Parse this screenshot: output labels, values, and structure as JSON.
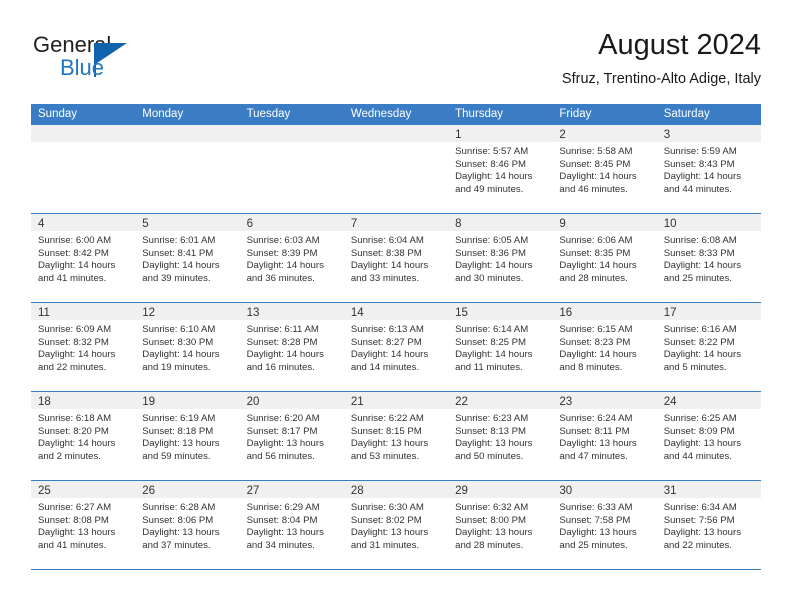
{
  "brand": {
    "name_part1": "General",
    "name_part2": "Blue",
    "accent_color": "#1263ad",
    "blue_text_color": "#1f76c2"
  },
  "header": {
    "title": "August 2024",
    "subtitle": "Sfruz, Trentino-Alto Adige, Italy"
  },
  "calendar": {
    "header_bg": "#3b7dc4",
    "day_strip_bg": "#f0f0f0",
    "weekdays": [
      "Sunday",
      "Monday",
      "Tuesday",
      "Wednesday",
      "Thursday",
      "Friday",
      "Saturday"
    ],
    "labels": {
      "sunrise": "Sunrise:",
      "sunset": "Sunset:",
      "daylight": "Daylight:"
    },
    "weeks": [
      [
        {
          "empty": true
        },
        {
          "empty": true
        },
        {
          "empty": true
        },
        {
          "empty": true
        },
        {
          "day": "1",
          "sunrise": "Sunrise: 5:57 AM",
          "sunset": "Sunset: 8:46 PM",
          "daylight_1": "Daylight: 14 hours",
          "daylight_2": "and 49 minutes."
        },
        {
          "day": "2",
          "sunrise": "Sunrise: 5:58 AM",
          "sunset": "Sunset: 8:45 PM",
          "daylight_1": "Daylight: 14 hours",
          "daylight_2": "and 46 minutes."
        },
        {
          "day": "3",
          "sunrise": "Sunrise: 5:59 AM",
          "sunset": "Sunset: 8:43 PM",
          "daylight_1": "Daylight: 14 hours",
          "daylight_2": "and 44 minutes."
        }
      ],
      [
        {
          "day": "4",
          "sunrise": "Sunrise: 6:00 AM",
          "sunset": "Sunset: 8:42 PM",
          "daylight_1": "Daylight: 14 hours",
          "daylight_2": "and 41 minutes."
        },
        {
          "day": "5",
          "sunrise": "Sunrise: 6:01 AM",
          "sunset": "Sunset: 8:41 PM",
          "daylight_1": "Daylight: 14 hours",
          "daylight_2": "and 39 minutes."
        },
        {
          "day": "6",
          "sunrise": "Sunrise: 6:03 AM",
          "sunset": "Sunset: 8:39 PM",
          "daylight_1": "Daylight: 14 hours",
          "daylight_2": "and 36 minutes."
        },
        {
          "day": "7",
          "sunrise": "Sunrise: 6:04 AM",
          "sunset": "Sunset: 8:38 PM",
          "daylight_1": "Daylight: 14 hours",
          "daylight_2": "and 33 minutes."
        },
        {
          "day": "8",
          "sunrise": "Sunrise: 6:05 AM",
          "sunset": "Sunset: 8:36 PM",
          "daylight_1": "Daylight: 14 hours",
          "daylight_2": "and 30 minutes."
        },
        {
          "day": "9",
          "sunrise": "Sunrise: 6:06 AM",
          "sunset": "Sunset: 8:35 PM",
          "daylight_1": "Daylight: 14 hours",
          "daylight_2": "and 28 minutes."
        },
        {
          "day": "10",
          "sunrise": "Sunrise: 6:08 AM",
          "sunset": "Sunset: 8:33 PM",
          "daylight_1": "Daylight: 14 hours",
          "daylight_2": "and 25 minutes."
        }
      ],
      [
        {
          "day": "11",
          "sunrise": "Sunrise: 6:09 AM",
          "sunset": "Sunset: 8:32 PM",
          "daylight_1": "Daylight: 14 hours",
          "daylight_2": "and 22 minutes."
        },
        {
          "day": "12",
          "sunrise": "Sunrise: 6:10 AM",
          "sunset": "Sunset: 8:30 PM",
          "daylight_1": "Daylight: 14 hours",
          "daylight_2": "and 19 minutes."
        },
        {
          "day": "13",
          "sunrise": "Sunrise: 6:11 AM",
          "sunset": "Sunset: 8:28 PM",
          "daylight_1": "Daylight: 14 hours",
          "daylight_2": "and 16 minutes."
        },
        {
          "day": "14",
          "sunrise": "Sunrise: 6:13 AM",
          "sunset": "Sunset: 8:27 PM",
          "daylight_1": "Daylight: 14 hours",
          "daylight_2": "and 14 minutes."
        },
        {
          "day": "15",
          "sunrise": "Sunrise: 6:14 AM",
          "sunset": "Sunset: 8:25 PM",
          "daylight_1": "Daylight: 14 hours",
          "daylight_2": "and 11 minutes."
        },
        {
          "day": "16",
          "sunrise": "Sunrise: 6:15 AM",
          "sunset": "Sunset: 8:23 PM",
          "daylight_1": "Daylight: 14 hours",
          "daylight_2": "and 8 minutes."
        },
        {
          "day": "17",
          "sunrise": "Sunrise: 6:16 AM",
          "sunset": "Sunset: 8:22 PM",
          "daylight_1": "Daylight: 14 hours",
          "daylight_2": "and 5 minutes."
        }
      ],
      [
        {
          "day": "18",
          "sunrise": "Sunrise: 6:18 AM",
          "sunset": "Sunset: 8:20 PM",
          "daylight_1": "Daylight: 14 hours",
          "daylight_2": "and 2 minutes."
        },
        {
          "day": "19",
          "sunrise": "Sunrise: 6:19 AM",
          "sunset": "Sunset: 8:18 PM",
          "daylight_1": "Daylight: 13 hours",
          "daylight_2": "and 59 minutes."
        },
        {
          "day": "20",
          "sunrise": "Sunrise: 6:20 AM",
          "sunset": "Sunset: 8:17 PM",
          "daylight_1": "Daylight: 13 hours",
          "daylight_2": "and 56 minutes."
        },
        {
          "day": "21",
          "sunrise": "Sunrise: 6:22 AM",
          "sunset": "Sunset: 8:15 PM",
          "daylight_1": "Daylight: 13 hours",
          "daylight_2": "and 53 minutes."
        },
        {
          "day": "22",
          "sunrise": "Sunrise: 6:23 AM",
          "sunset": "Sunset: 8:13 PM",
          "daylight_1": "Daylight: 13 hours",
          "daylight_2": "and 50 minutes."
        },
        {
          "day": "23",
          "sunrise": "Sunrise: 6:24 AM",
          "sunset": "Sunset: 8:11 PM",
          "daylight_1": "Daylight: 13 hours",
          "daylight_2": "and 47 minutes."
        },
        {
          "day": "24",
          "sunrise": "Sunrise: 6:25 AM",
          "sunset": "Sunset: 8:09 PM",
          "daylight_1": "Daylight: 13 hours",
          "daylight_2": "and 44 minutes."
        }
      ],
      [
        {
          "day": "25",
          "sunrise": "Sunrise: 6:27 AM",
          "sunset": "Sunset: 8:08 PM",
          "daylight_1": "Daylight: 13 hours",
          "daylight_2": "and 41 minutes."
        },
        {
          "day": "26",
          "sunrise": "Sunrise: 6:28 AM",
          "sunset": "Sunset: 8:06 PM",
          "daylight_1": "Daylight: 13 hours",
          "daylight_2": "and 37 minutes."
        },
        {
          "day": "27",
          "sunrise": "Sunrise: 6:29 AM",
          "sunset": "Sunset: 8:04 PM",
          "daylight_1": "Daylight: 13 hours",
          "daylight_2": "and 34 minutes."
        },
        {
          "day": "28",
          "sunrise": "Sunrise: 6:30 AM",
          "sunset": "Sunset: 8:02 PM",
          "daylight_1": "Daylight: 13 hours",
          "daylight_2": "and 31 minutes."
        },
        {
          "day": "29",
          "sunrise": "Sunrise: 6:32 AM",
          "sunset": "Sunset: 8:00 PM",
          "daylight_1": "Daylight: 13 hours",
          "daylight_2": "and 28 minutes."
        },
        {
          "day": "30",
          "sunrise": "Sunrise: 6:33 AM",
          "sunset": "Sunset: 7:58 PM",
          "daylight_1": "Daylight: 13 hours",
          "daylight_2": "and 25 minutes."
        },
        {
          "day": "31",
          "sunrise": "Sunrise: 6:34 AM",
          "sunset": "Sunset: 7:56 PM",
          "daylight_1": "Daylight: 13 hours",
          "daylight_2": "and 22 minutes."
        }
      ]
    ]
  }
}
